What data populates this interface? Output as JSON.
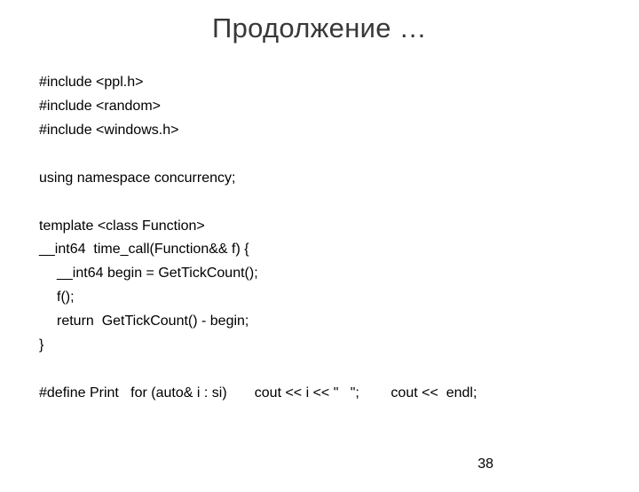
{
  "title": "Продолжение …",
  "lines": {
    "l0": "#include <ppl.h>",
    "l1": "#include <random>",
    "l2": "#include <windows.h>",
    "l3": "using namespace concurrency;",
    "l4": "template <class Function>",
    "l5": "__int64  time_call(Function&& f) {",
    "l6": "__int64 begin = GetTickCount();",
    "l7": "f();",
    "l8": "return  GetTickCount() - begin;",
    "l9": "}",
    "l10": "#define Print   for (auto& i : si)       cout << i << \"   \";        cout <<  endl;"
  },
  "page_number": "38"
}
